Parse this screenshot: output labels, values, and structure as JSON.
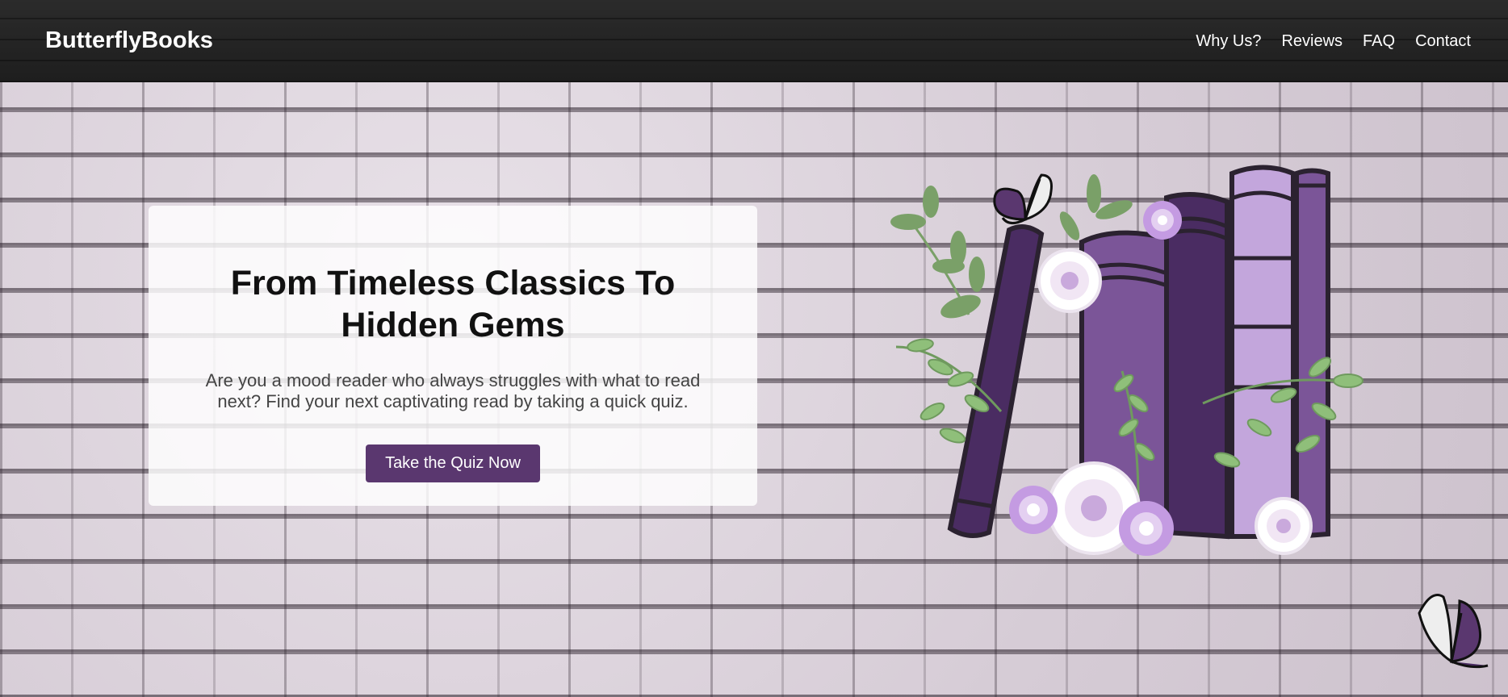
{
  "header": {
    "brand": "ButterflyBooks",
    "nav": [
      {
        "label": "Why Us?"
      },
      {
        "label": "Reviews"
      },
      {
        "label": "FAQ"
      },
      {
        "label": "Contact"
      }
    ]
  },
  "hero": {
    "title": "From Timeless Classics To Hidden Gems",
    "subtitle": "Are you a mood reader who always struggles with what to read next? Find your next captivating read by taking a quick quiz.",
    "cta_label": "Take the Quiz Now"
  },
  "colors": {
    "accent": "#5a376f",
    "header_bg": "#222222",
    "book_dark": "#4a2c62",
    "book_mid": "#7b5598",
    "book_light": "#c3a6dc",
    "leaf": "#8fbf7a"
  },
  "icons": {
    "illustration": "books-flowers-illustration",
    "butterfly": "butterfly-icon"
  }
}
